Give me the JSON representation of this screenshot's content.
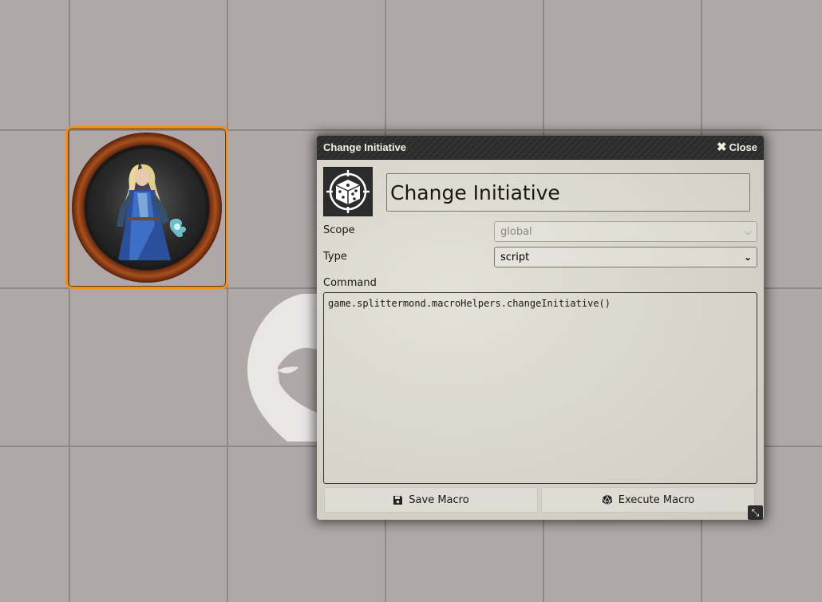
{
  "dialog": {
    "title": "Change Initiative",
    "close_label": "Close",
    "macro_name": "Change Initiative",
    "scope_label": "Scope",
    "scope_value": "global",
    "type_label": "Type",
    "type_value": "script",
    "command_label": "Command",
    "command_value": "game.splittermond.macroHelpers.changeInitiative()",
    "save_label": "Save Macro",
    "execute_label": "Execute Macro"
  },
  "icons": {
    "macro_image": "dice-target-icon",
    "close": "close-icon",
    "save": "floppy-disk-icon",
    "execute": "dice-d20-icon",
    "resize": "resize-icon"
  },
  "colors": {
    "canvas_background": "#b0a8a8",
    "grid_line": "#8f8888",
    "token_border": "#f0901e",
    "dialog_header": "#2f2f2f"
  }
}
